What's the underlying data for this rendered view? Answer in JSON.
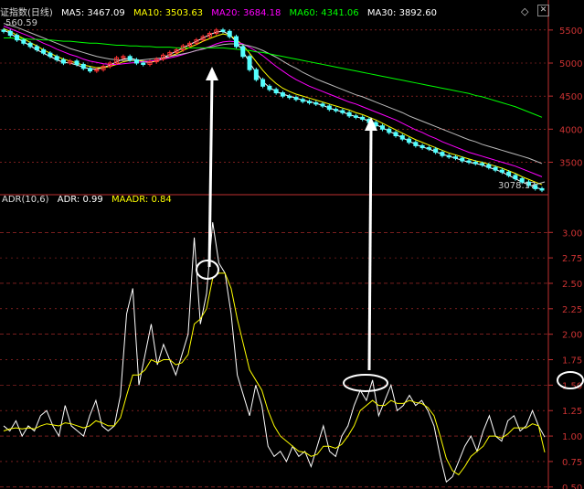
{
  "header": {
    "index_name": "证指数(日线)",
    "ma5_label": "MA5:",
    "ma5_value": "3467.09",
    "ma10_label": "MA10:",
    "ma10_value": "3503.63",
    "ma20_label": "MA20:",
    "ma20_value": "3684.18",
    "ma60_label": "MA60:",
    "ma60_value": "4341.06",
    "ma30_label": "MA30:",
    "ma30_value": "3892.60",
    "high_mark": "560.59",
    "low_mark": "3078.17",
    "diamond_icon": "diamond-icon",
    "close_icon": "close-icon"
  },
  "adr_panel": {
    "title": "ADR(10,6)",
    "adr_label": "ADR:",
    "adr_value": "0.99",
    "maadr_label": "MAADR:",
    "maadr_value": "0.84"
  },
  "colors": {
    "background": "#000000",
    "axis_red": "#c03030",
    "up_candle": "#ff3333",
    "down_candle": "#54ffff",
    "ma5": "#ffffff",
    "ma10": "#ffff00",
    "ma20": "#ff00ff",
    "ma30": "#ffffff",
    "ma60": "#00ff00",
    "adr_line": "#ffffff",
    "maadr_line": "#ffff00"
  },
  "chart_data": [
    {
      "type": "line",
      "panel": "price",
      "ylim": [
        3050,
        5650
      ],
      "yticks": [
        3500,
        4000,
        4500,
        5000,
        5500
      ],
      "price_candles_close": [
        5480,
        5420,
        5350,
        5300,
        5250,
        5200,
        5150,
        5100,
        5050,
        5000,
        5030,
        4980,
        4920,
        4880,
        4900,
        4950,
        5000,
        5080,
        5100,
        5050,
        5000,
        4980,
        5020,
        5060,
        5120,
        5160,
        5200,
        5260,
        5300,
        5350,
        5400,
        5450,
        5500,
        5480,
        5400,
        5250,
        5100,
        4900,
        4750,
        4650,
        4600,
        4550,
        4500,
        4480,
        4450,
        4420,
        4400,
        4380,
        4350,
        4300,
        4280,
        4250,
        4200,
        4180,
        4150,
        4100,
        4050,
        4000,
        3950,
        3900,
        3850,
        3800,
        3750,
        3720,
        3700,
        3650,
        3600,
        3580,
        3560,
        3520,
        3500,
        3480,
        3460,
        3420,
        3380,
        3350,
        3300,
        3250,
        3200,
        3150,
        3100,
        3078
      ],
      "series": [
        {
          "name": "MA5",
          "values": [
            5500,
            5450,
            5380,
            5320,
            5260,
            5200,
            5150,
            5100,
            5050,
            5010,
            5000,
            4970,
            4940,
            4910,
            4910,
            4930,
            4970,
            5020,
            5060,
            5070,
            5050,
            5020,
            5010,
            5030,
            5080,
            5130,
            5180,
            5230,
            5280,
            5330,
            5380,
            5430,
            5470,
            5480,
            5430,
            5320,
            5180,
            5010,
            4850,
            4720,
            4630,
            4570,
            4530,
            4500,
            4470,
            4440,
            4420,
            4390,
            4360,
            4320,
            4290,
            4260,
            4220,
            4190,
            4160,
            4120,
            4070,
            4020,
            3970,
            3920,
            3870,
            3820,
            3770,
            3730,
            3700,
            3660,
            3620,
            3590,
            3560,
            3530,
            3500,
            3480,
            3460,
            3420,
            3390,
            3350,
            3300,
            3250,
            3200,
            3160,
            3120,
            3090
          ]
        },
        {
          "name": "MA10",
          "values": [
            5520,
            5480,
            5420,
            5370,
            5310,
            5260,
            5200,
            5150,
            5100,
            5060,
            5030,
            5000,
            4970,
            4950,
            4930,
            4930,
            4950,
            4980,
            5020,
            5040,
            5040,
            5030,
            5020,
            5030,
            5060,
            5100,
            5140,
            5190,
            5240,
            5280,
            5330,
            5370,
            5410,
            5440,
            5420,
            5360,
            5270,
            5150,
            5020,
            4890,
            4780,
            4690,
            4620,
            4570,
            4530,
            4500,
            4470,
            4440,
            4410,
            4380,
            4350,
            4320,
            4290,
            4250,
            4220,
            4180,
            4140,
            4090,
            4040,
            3990,
            3940,
            3890,
            3840,
            3800,
            3760,
            3720,
            3680,
            3640,
            3610,
            3580,
            3550,
            3520,
            3500,
            3470,
            3440,
            3410,
            3370,
            3330,
            3280,
            3240,
            3200,
            3160
          ]
        },
        {
          "name": "MA20",
          "values": [
            5560,
            5520,
            5480,
            5440,
            5400,
            5350,
            5300,
            5260,
            5210,
            5170,
            5130,
            5100,
            5060,
            5030,
            5010,
            4990,
            4980,
            4980,
            4990,
            5000,
            5010,
            5020,
            5030,
            5040,
            5060,
            5080,
            5100,
            5130,
            5160,
            5190,
            5220,
            5250,
            5290,
            5320,
            5330,
            5320,
            5290,
            5240,
            5180,
            5110,
            5030,
            4950,
            4880,
            4810,
            4750,
            4700,
            4650,
            4610,
            4570,
            4530,
            4490,
            4450,
            4410,
            4380,
            4340,
            4300,
            4260,
            4220,
            4180,
            4140,
            4090,
            4040,
            3990,
            3950,
            3900,
            3860,
            3810,
            3770,
            3730,
            3690,
            3650,
            3620,
            3590,
            3560,
            3530,
            3500,
            3470,
            3440,
            3400,
            3360,
            3320,
            3280
          ]
        },
        {
          "name": "MA30",
          "values": [
            5600,
            5570,
            5540,
            5500,
            5460,
            5420,
            5380,
            5340,
            5300,
            5260,
            5220,
            5190,
            5160,
            5130,
            5100,
            5080,
            5060,
            5050,
            5040,
            5040,
            5040,
            5050,
            5060,
            5070,
            5080,
            5100,
            5120,
            5140,
            5160,
            5190,
            5210,
            5240,
            5260,
            5280,
            5290,
            5290,
            5280,
            5260,
            5230,
            5190,
            5140,
            5090,
            5030,
            4970,
            4920,
            4860,
            4810,
            4760,
            4720,
            4680,
            4640,
            4600,
            4560,
            4520,
            4490,
            4450,
            4410,
            4370,
            4330,
            4290,
            4250,
            4200,
            4160,
            4120,
            4080,
            4040,
            4000,
            3960,
            3920,
            3880,
            3840,
            3810,
            3770,
            3740,
            3710,
            3680,
            3650,
            3620,
            3590,
            3560,
            3520,
            3480
          ]
        },
        {
          "name": "MA60",
          "values": [
            5380,
            5380,
            5370,
            5370,
            5360,
            5360,
            5350,
            5350,
            5340,
            5330,
            5330,
            5320,
            5310,
            5300,
            5300,
            5290,
            5280,
            5270,
            5270,
            5260,
            5260,
            5250,
            5250,
            5240,
            5240,
            5240,
            5230,
            5230,
            5230,
            5230,
            5230,
            5230,
            5230,
            5230,
            5220,
            5210,
            5200,
            5190,
            5170,
            5160,
            5140,
            5120,
            5100,
            5080,
            5060,
            5040,
            5020,
            5000,
            4980,
            4960,
            4940,
            4920,
            4900,
            4880,
            4860,
            4840,
            4820,
            4800,
            4780,
            4760,
            4740,
            4720,
            4700,
            4680,
            4660,
            4640,
            4620,
            4600,
            4580,
            4560,
            4540,
            4510,
            4490,
            4460,
            4430,
            4400,
            4370,
            4340,
            4300,
            4260,
            4220,
            4180
          ]
        }
      ]
    },
    {
      "type": "line",
      "panel": "adr",
      "title": "ADR(10,6)",
      "ylim": [
        0.48,
        3.2
      ],
      "yticks": [
        "0.50",
        "0.75",
        "1.00",
        "1.25",
        "1.50",
        "1.75",
        "2.00",
        "2.25",
        "2.50",
        "2.75",
        "3.00"
      ],
      "series": [
        {
          "name": "ADR",
          "values": [
            1.1,
            1.05,
            1.15,
            1.0,
            1.1,
            1.05,
            1.2,
            1.25,
            1.1,
            1.0,
            1.3,
            1.1,
            1.05,
            1.0,
            1.2,
            1.35,
            1.1,
            1.05,
            1.1,
            1.4,
            2.2,
            2.45,
            1.5,
            1.8,
            2.1,
            1.7,
            1.9,
            1.75,
            1.6,
            1.8,
            2.0,
            2.95,
            2.1,
            2.4,
            3.1,
            2.7,
            2.6,
            2.2,
            1.6,
            1.4,
            1.2,
            1.5,
            1.3,
            0.9,
            0.8,
            0.85,
            0.75,
            0.9,
            0.8,
            0.85,
            0.7,
            0.9,
            1.1,
            0.85,
            0.8,
            1.0,
            1.1,
            1.3,
            1.45,
            1.35,
            1.55,
            1.2,
            1.35,
            1.5,
            1.25,
            1.3,
            1.4,
            1.3,
            1.35,
            1.25,
            1.1,
            0.8,
            0.55,
            0.6,
            0.75,
            0.9,
            1.0,
            0.85,
            1.05,
            1.2,
            1.0,
            0.95,
            1.15,
            1.2,
            1.05,
            1.1,
            1.25,
            1.1,
            0.99
          ]
        },
        {
          "name": "MAADR",
          "values": [
            1.05,
            1.07,
            1.08,
            1.07,
            1.08,
            1.07,
            1.1,
            1.12,
            1.11,
            1.1,
            1.13,
            1.12,
            1.1,
            1.08,
            1.1,
            1.15,
            1.13,
            1.1,
            1.1,
            1.18,
            1.4,
            1.6,
            1.6,
            1.65,
            1.75,
            1.72,
            1.75,
            1.75,
            1.7,
            1.72,
            1.8,
            2.1,
            2.15,
            2.25,
            2.55,
            2.6,
            2.6,
            2.45,
            2.15,
            1.9,
            1.65,
            1.55,
            1.45,
            1.25,
            1.1,
            1.0,
            0.95,
            0.9,
            0.85,
            0.84,
            0.8,
            0.82,
            0.9,
            0.9,
            0.88,
            0.92,
            1.0,
            1.1,
            1.25,
            1.3,
            1.35,
            1.3,
            1.3,
            1.35,
            1.32,
            1.32,
            1.35,
            1.33,
            1.32,
            1.28,
            1.2,
            1.0,
            0.78,
            0.66,
            0.62,
            0.7,
            0.8,
            0.85,
            0.9,
            1.0,
            1.0,
            0.98,
            1.02,
            1.08,
            1.08,
            1.08,
            1.12,
            1.1,
            0.84
          ]
        }
      ]
    }
  ]
}
